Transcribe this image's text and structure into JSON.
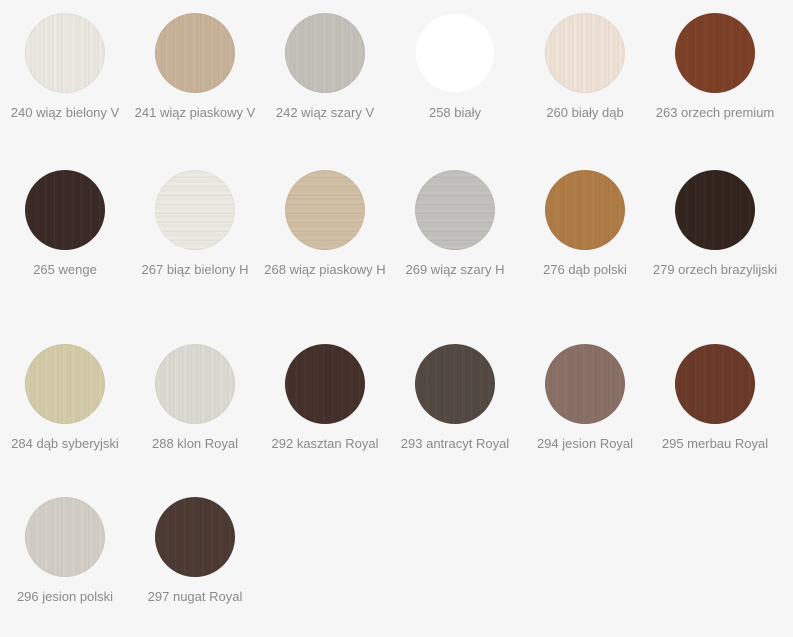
{
  "swatches": [
    {
      "code": "240 wiąz bielony V",
      "color": "#ebe9e2",
      "grain": "v"
    },
    {
      "code": "241 wiąz piaskowy V",
      "color": "#c9b49a",
      "grain": "v"
    },
    {
      "code": "242 wiąz szary V",
      "color": "#c4c2bb",
      "grain": "v"
    },
    {
      "code": "258 biały",
      "color": "#ffffff",
      "grain": "none"
    },
    {
      "code": "260 biały dąb",
      "color": "#f0e3d8",
      "grain": "v"
    },
    {
      "code": "263 orzech premium",
      "color": "#7d4027",
      "grain": "v"
    },
    {
      "code": "265 wenge",
      "color": "#3b2a25",
      "grain": "v"
    },
    {
      "code": "267 biąz bielony H",
      "color": "#ecebe3",
      "grain": "h"
    },
    {
      "code": "268 wiąz piaskowy H",
      "color": "#d2c0a6",
      "grain": "h"
    },
    {
      "code": "269 wiąz szary H",
      "color": "#c3c2be",
      "grain": "h"
    },
    {
      "code": "276 dąb polski",
      "color": "#b07c46",
      "grain": "v"
    },
    {
      "code": "279 orzech brazylijski",
      "color": "#33241e",
      "grain": "v"
    },
    {
      "code": "284 dąb syberyjski",
      "color": "#d5ccaa",
      "grain": "v"
    },
    {
      "code": "288 klon Royal",
      "color": "#dcdbd4",
      "grain": "v"
    },
    {
      "code": "292 kasztan Royal",
      "color": "#45312b",
      "grain": "v"
    },
    {
      "code": "293 antracyt Royal",
      "color": "#534942",
      "grain": "v"
    },
    {
      "code": "294 jesion Royal",
      "color": "#8a7067",
      "grain": "v"
    },
    {
      "code": "295 merbau Royal",
      "color": "#6b3a29",
      "grain": "v"
    },
    {
      "code": "296 jesion polski",
      "color": "#d4d0c8",
      "grain": "v"
    },
    {
      "code": "297 nugat Royal",
      "color": "#4c3a33",
      "grain": "v"
    }
  ]
}
